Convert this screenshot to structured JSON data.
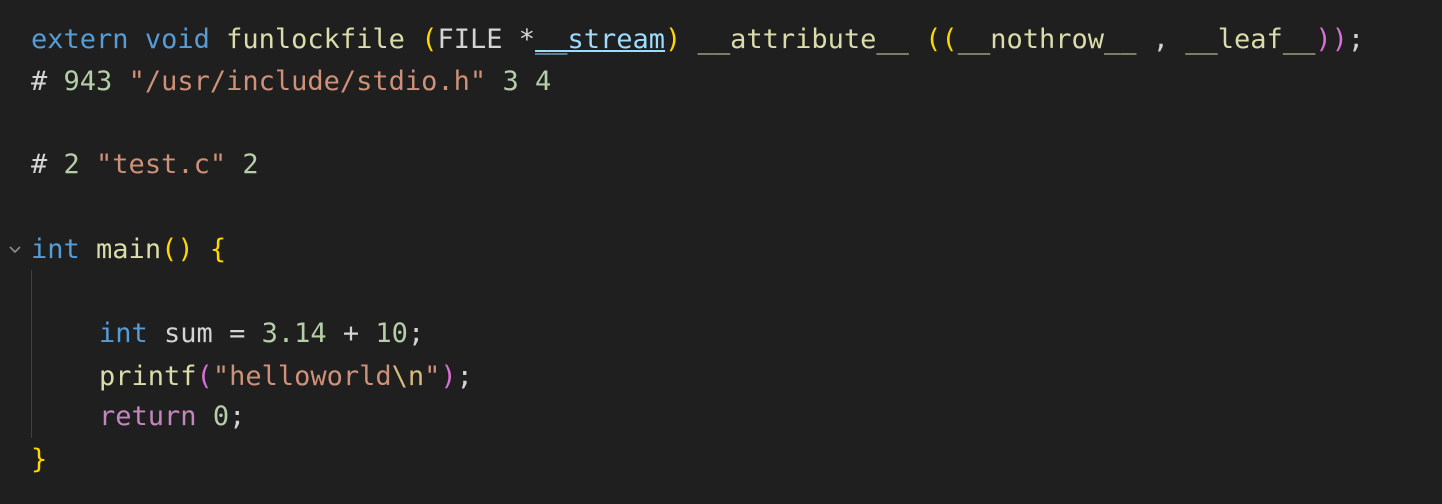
{
  "code": {
    "line1": {
      "extern": "extern",
      "void": "void",
      "name": "funlockfile",
      "open": "(",
      "type": "FILE",
      "star": " *",
      "param": "__stream",
      "close": ")",
      "attr": "__attribute__",
      "open2": "((",
      "nothrow": "__nothrow__",
      "comma": " , ",
      "leaf": "__leaf__",
      "close2": "))",
      "semi": ";"
    },
    "line2": {
      "hash": "# ",
      "num": "943",
      "path": "\"/usr/include/stdio.h\"",
      "flag1": "3",
      "flag2": "4"
    },
    "line3": {
      "hash": "# ",
      "num": "2",
      "file": "\"test.c\"",
      "flag": "2"
    },
    "line4": {
      "int": "int",
      "main": "main",
      "parens": "()",
      "brace": "{"
    },
    "line5": {
      "int": "int",
      "var": "sum",
      "eq": " = ",
      "a": "3.14",
      "plus": " + ",
      "b": "10",
      "semi": ";"
    },
    "line6": {
      "fn": "printf",
      "open": "(",
      "str": "\"helloworld",
      "esc": "\\n",
      "strEnd": "\"",
      "close": ")",
      "semi": ";"
    },
    "line7": {
      "ret": "return",
      "val": "0",
      "semi": ";"
    },
    "line8": {
      "brace": "}"
    }
  },
  "icons": {
    "fold": "chevron-down-icon"
  },
  "colors": {
    "background": "#1f1f1f",
    "keyword": "#569cd6",
    "control": "#c586c0",
    "function": "#dcdcaa",
    "variable": "#9cdcfe",
    "number": "#b5cea8",
    "string": "#ce9178",
    "bracket1": "#ffd700",
    "bracket2": "#da70d6",
    "bracket3": "#179fff"
  }
}
